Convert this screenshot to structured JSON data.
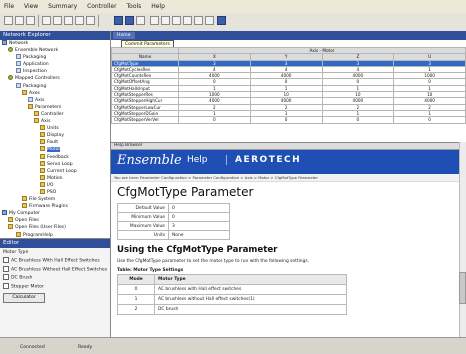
{
  "menu": [
    "File",
    "View",
    "Summary",
    "Controller",
    "Tools",
    "Help"
  ],
  "left_panel": {
    "title": "Network Explorer",
    "tree": [
      "Network",
      "Ensemble Network",
      "Packaging",
      "Application",
      "Inspection",
      "Mapped Controllers",
      "Packaging",
      "Axes",
      "Axis",
      "Parameters",
      "Controller",
      "Axis",
      "Units",
      "Display",
      "Fault",
      "Motor",
      "Feedback",
      "Servo Loop",
      "Current Loop",
      "Motion",
      "I/O",
      "PSO",
      "File System",
      "Firmware Plugins",
      "My Computer",
      "Open Files",
      "Open Files (User Files)",
      "ProgramHelp",
      "Packaging.pmw"
    ],
    "selected_tree_item": "Motor"
  },
  "filter_panel": {
    "title": "Editor",
    "subtitle": "Motor Type",
    "options": [
      "AC Brushless With Hall Effect Switches",
      "AC Brushless Without Hall Effect Switches",
      "DC Brush",
      "Stepper Motor"
    ],
    "calculator_label": "Calculator"
  },
  "param_table": {
    "tab_label": "Home",
    "tooltip": "Commit Parameters",
    "axes_header": "Axis - Motor",
    "columns": [
      "Name",
      "X",
      "Y",
      "Z",
      "U"
    ],
    "rows": [
      {
        "name": "CfgMotType",
        "values": [
          "3",
          "3",
          "3",
          "3"
        ]
      },
      {
        "name": "CfgMotCyclesRev",
        "values": [
          "4",
          "4",
          "4",
          "1"
        ]
      },
      {
        "name": "CfgMotCountsRev",
        "values": [
          "4000",
          "4000",
          "4000",
          "1000"
        ]
      },
      {
        "name": "CfgMotOffsetAng",
        "values": [
          "0",
          "0",
          "0",
          "0"
        ]
      },
      {
        "name": "CfgMotHallsInput",
        "values": [
          "1",
          "1",
          "1",
          "1"
        ]
      },
      {
        "name": "CfgMotStepperRes",
        "values": [
          "1000",
          "10",
          "10",
          "10"
        ]
      },
      {
        "name": "CfgMotStepperHighCur",
        "values": [
          "4000",
          "4000",
          "4000",
          "4000"
        ]
      },
      {
        "name": "CfgMotStepperLowCur",
        "values": [
          "2",
          "2",
          "2",
          "2"
        ]
      },
      {
        "name": "CfgMotStepperDGain",
        "values": [
          "1",
          "1",
          "1",
          "1"
        ]
      },
      {
        "name": "CfgMotStepperVerVel",
        "values": [
          "0",
          "0",
          "0",
          "0"
        ]
      }
    ]
  },
  "help": {
    "title": "Help Browser",
    "brand": "Ensemble",
    "help_word": "Help",
    "company": "AEROTECH",
    "breadcrumb": "You are here: Parameter Configuration > Parameter Configuration > Axis > Motor > CfgMotType Parameter",
    "heading": "CfgMotType Parameter",
    "properties": [
      {
        "key": "Default Value",
        "value": "0"
      },
      {
        "key": "Minimum Value",
        "value": "0"
      },
      {
        "key": "Maximum Value",
        "value": "3"
      },
      {
        "key": "Units",
        "value": "None"
      }
    ],
    "subheading": "Using the CfgMotType Parameter",
    "paragraph": "Use the CfgMotType parameter to set the motor type to run with the following settings.",
    "table_caption": "Table: Motor Type Settings",
    "modes_header": [
      "Mode",
      "Motor Type"
    ],
    "modes": [
      {
        "mode": "0",
        "type": "AC brushless with Hall effect switches"
      },
      {
        "mode": "1",
        "type": "AC brushless without Hall effect switches(1)"
      },
      {
        "mode": "2",
        "type": "DC brush"
      }
    ]
  },
  "status": {
    "left": "Connected",
    "middle": "Ready"
  }
}
